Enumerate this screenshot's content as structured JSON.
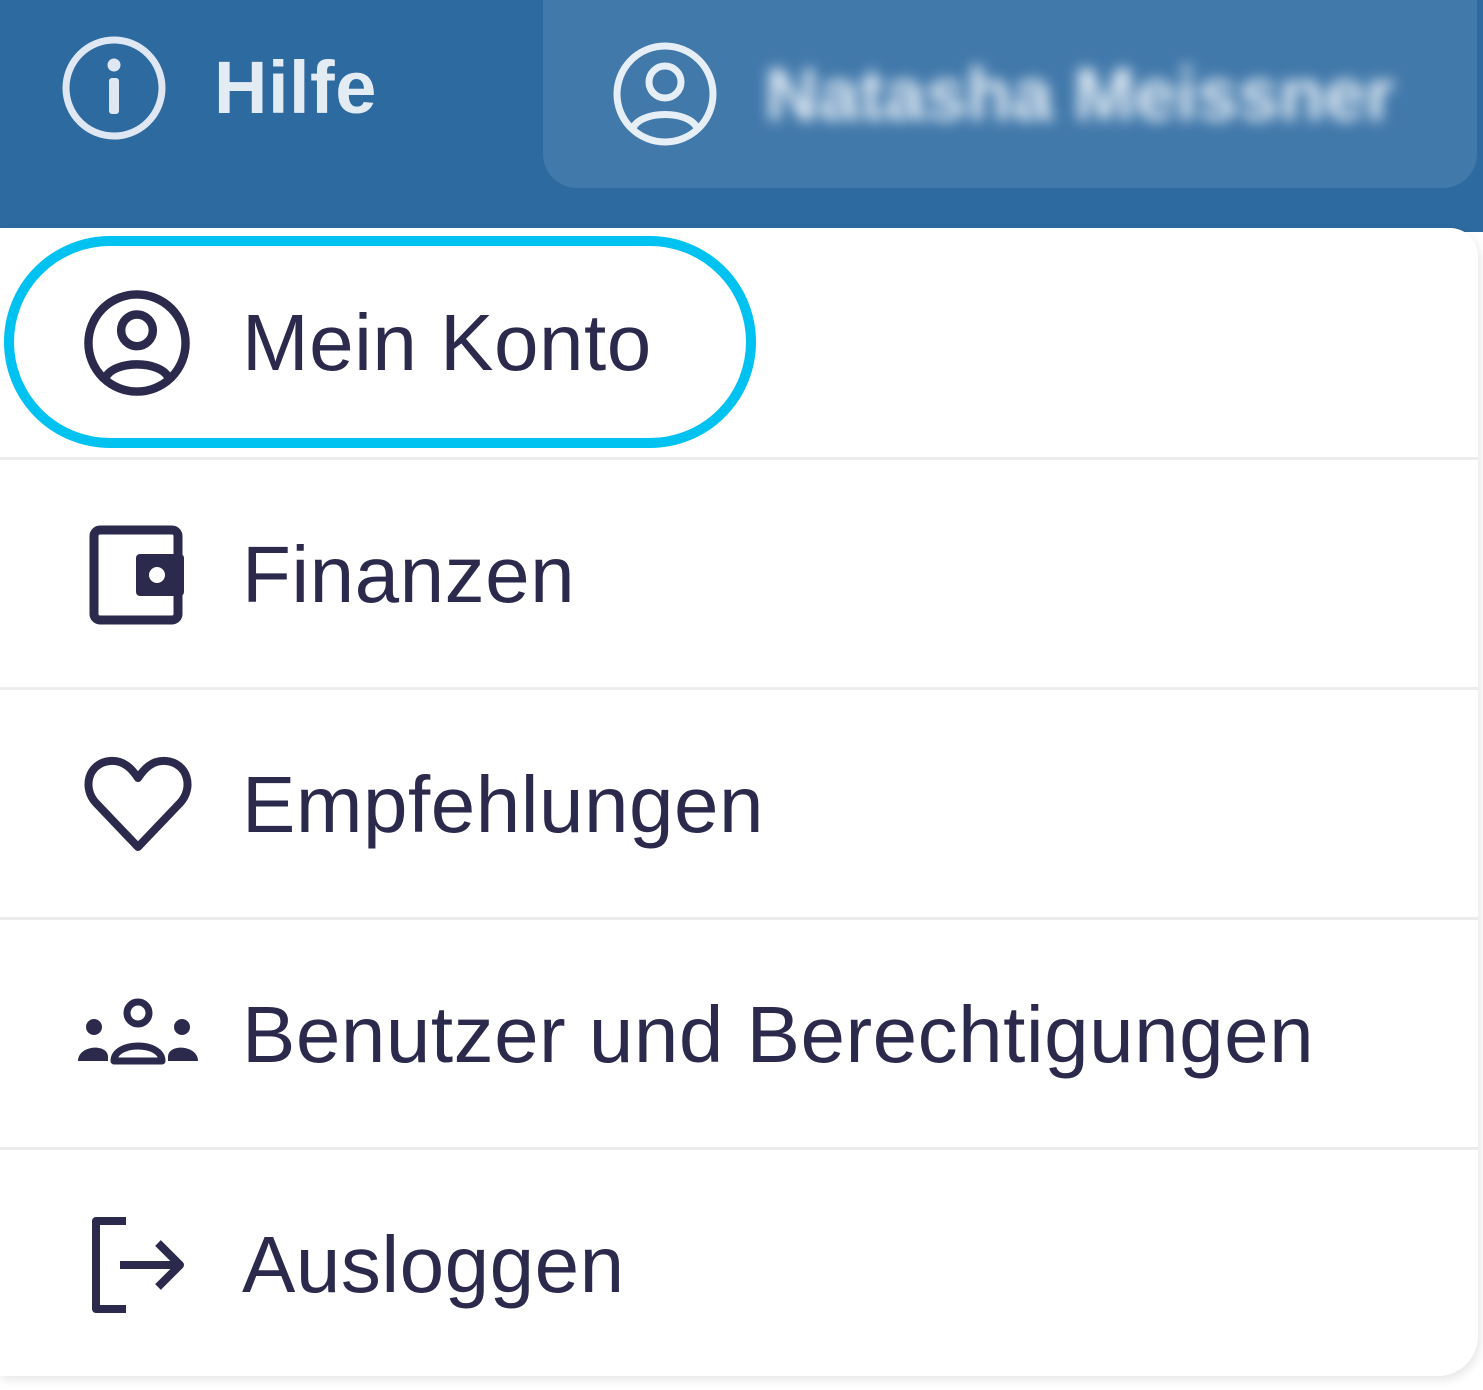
{
  "header": {
    "help_label": "Hilfe",
    "user_name": "Natasha Meissner"
  },
  "menu": {
    "items": [
      {
        "label": "Mein Konto",
        "icon": "user-circle-icon",
        "focused": true
      },
      {
        "label": "Finanzen",
        "icon": "wallet-icon"
      },
      {
        "label": "Empfehlungen",
        "icon": "heart-icon"
      },
      {
        "label": "Benutzer und Berechtigungen",
        "icon": "users-group-icon"
      },
      {
        "label": "Ausloggen",
        "icon": "logout-icon"
      }
    ]
  },
  "colors": {
    "header_bg": "#2d6aa0",
    "user_button_bg": "#4279ab",
    "menu_text": "#2b2a4c",
    "focus_ring": "#00c2f0"
  }
}
